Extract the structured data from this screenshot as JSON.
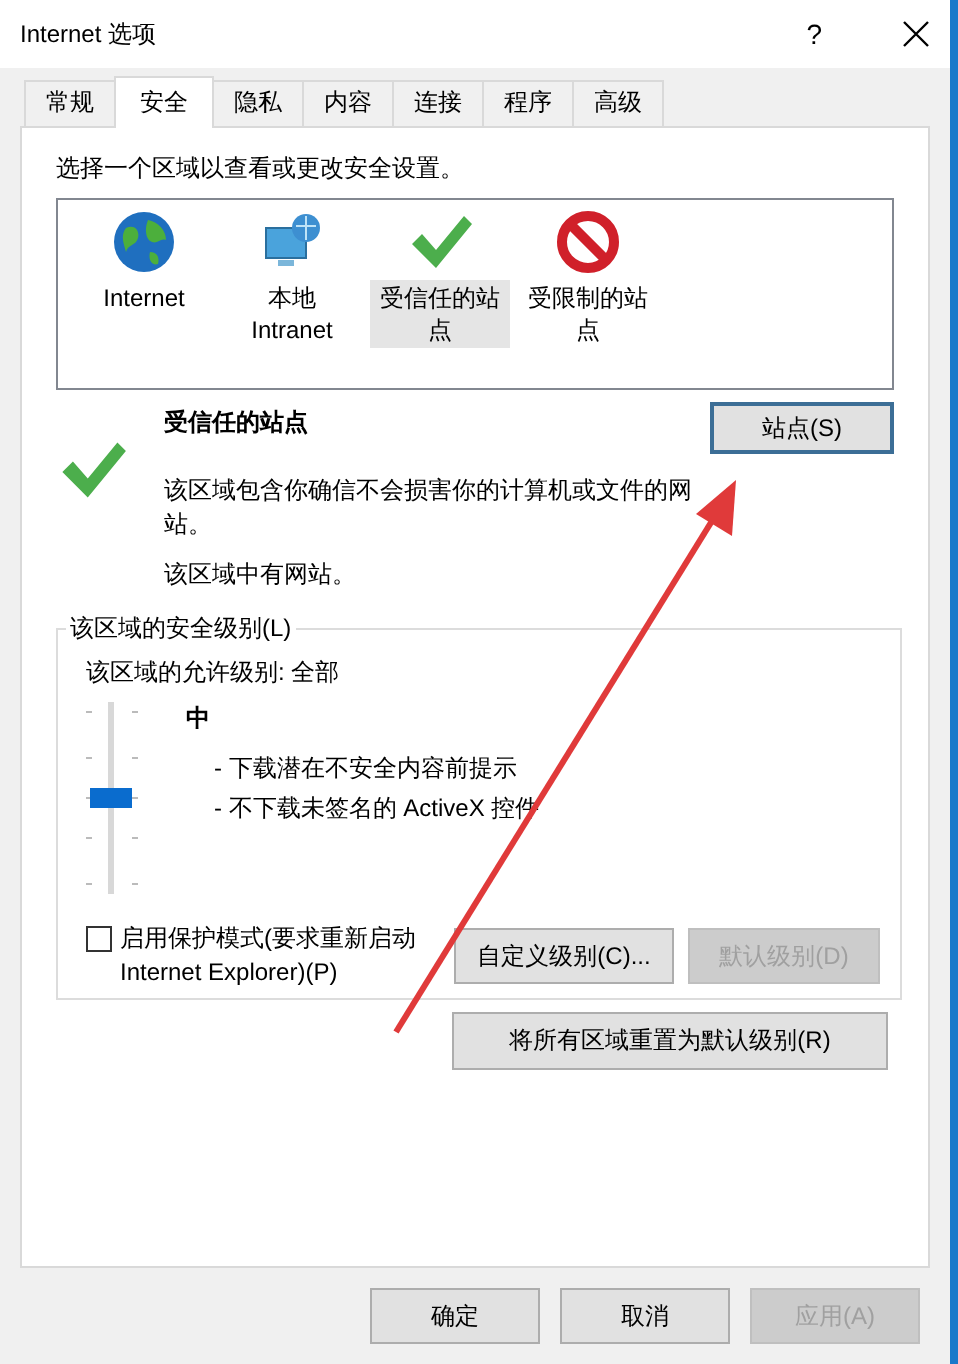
{
  "window": {
    "title": "Internet 选项",
    "help": "?"
  },
  "tabs": [
    {
      "label": "常规",
      "selected": false
    },
    {
      "label": "安全",
      "selected": true
    },
    {
      "label": "隐私",
      "selected": false
    },
    {
      "label": "内容",
      "selected": false
    },
    {
      "label": "连接",
      "selected": false
    },
    {
      "label": "程序",
      "selected": false
    },
    {
      "label": "高级",
      "selected": false
    }
  ],
  "zone_prompt": "选择一个区域以查看或更改安全设置。",
  "zones": [
    {
      "label": "Internet",
      "kind": "globe",
      "selected": false
    },
    {
      "label": "本地 Intranet",
      "kind": "computer",
      "selected": false
    },
    {
      "label": "受信任的站点",
      "kind": "check",
      "selected": true
    },
    {
      "label": "受限制的站点",
      "kind": "forbidden",
      "selected": false
    }
  ],
  "zone_detail": {
    "title": "受信任的站点",
    "description": "该区域包含你确信不会损害你的计算机或文件的网站。",
    "note": "该区域中有网站。",
    "sites_button": "站点(S)"
  },
  "security_level": {
    "legend": "该区域的安全级别(L)",
    "allowed": "该区域的允许级别: 全部",
    "level": 0.5,
    "level_name": "中",
    "bullets": [
      "- 下载潜在不安全内容前提示",
      "- 不下载未签名的 ActiveX 控件"
    ]
  },
  "protected_mode": {
    "label": "启用保护模式(要求重新启动 Internet Explorer)(P)",
    "checked": false
  },
  "level_buttons": [
    {
      "label": "自定义级别(C)...",
      "disabled": false
    },
    {
      "label": "默认级别(D)",
      "disabled": true
    }
  ],
  "reset_button": "将所有区域重置为默认级别(R)",
  "footer_buttons": [
    {
      "label": "确定",
      "disabled": false
    },
    {
      "label": "取消",
      "disabled": false
    },
    {
      "label": "应用(A)",
      "disabled": true
    }
  ]
}
